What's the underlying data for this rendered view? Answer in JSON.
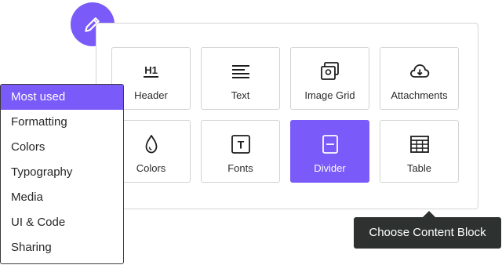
{
  "accent_color": "#7a5af8",
  "edit_icon": "pencil-icon",
  "blocks": [
    {
      "label": "Header",
      "icon": "h1-icon",
      "icon_text": "H1"
    },
    {
      "label": "Text",
      "icon": "text-lines-icon"
    },
    {
      "label": "Image Grid",
      "icon": "image-grid-icon"
    },
    {
      "label": "Attachments",
      "icon": "cloud-download-icon"
    },
    {
      "label": "Colors",
      "icon": "droplet-icon"
    },
    {
      "label": "Fonts",
      "icon": "font-box-icon",
      "icon_text": "T"
    },
    {
      "label": "Divider",
      "icon": "divider-icon",
      "selected": true
    },
    {
      "label": "Table",
      "icon": "table-icon"
    }
  ],
  "menu": {
    "items": [
      "Most used",
      "Formatting",
      "Colors",
      "Typography",
      "Media",
      "UI & Code",
      "Sharing"
    ],
    "active": "Most used"
  },
  "tooltip": {
    "text": "Choose Content Block"
  }
}
